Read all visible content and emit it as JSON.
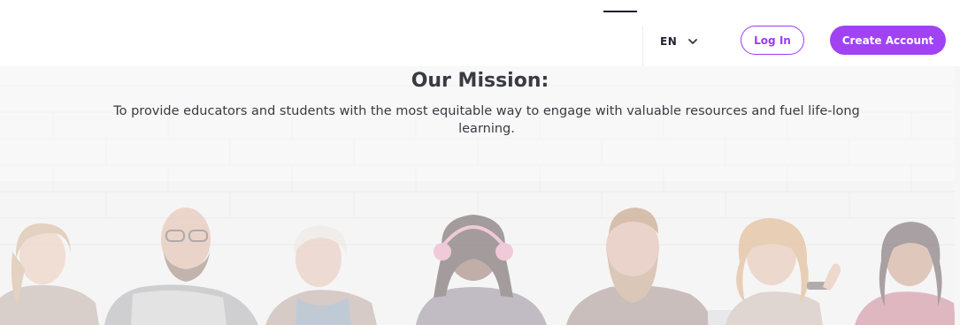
{
  "header": {
    "language": "EN",
    "login_label": "Log In",
    "create_account_label": "Create Account",
    "icons": {
      "language_chevron": "chevron-down-icon"
    }
  },
  "hero": {
    "title": "Our Mission:",
    "text": "To provide educators and students with the most equitable way to engage with valuable resources and fuel life-long learning.",
    "image": "group-of-smiling-people-photo"
  },
  "colors": {
    "accent": "#a142f4",
    "accent_border": "#9d3bf0",
    "text_dark": "#3a3a44",
    "background": "#ffffff"
  }
}
